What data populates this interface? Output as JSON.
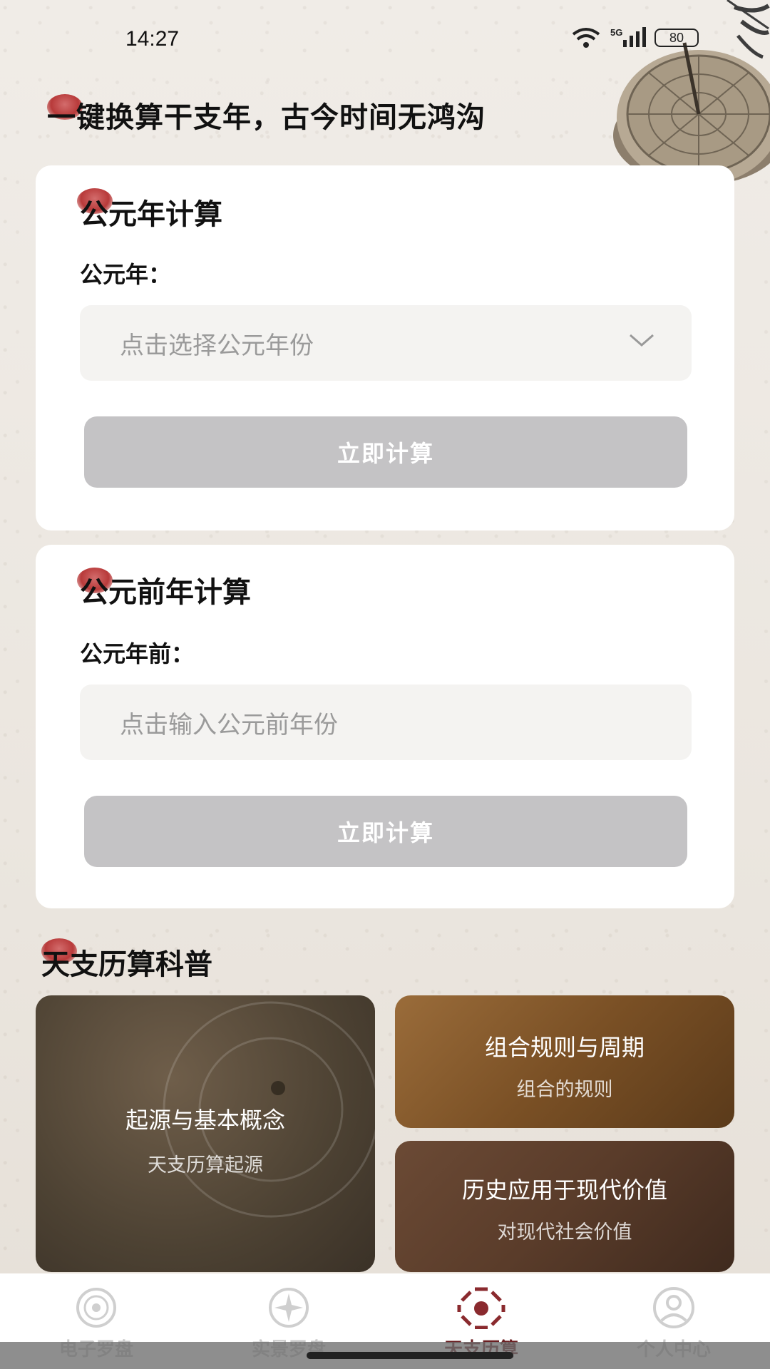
{
  "status": {
    "time": "14:27",
    "network": "5G",
    "battery": "80"
  },
  "headline": "一键换算干支年，古今时间无鸿沟",
  "ad_card": {
    "title": "公元年计算",
    "label": "公元年：",
    "placeholder": "点击选择公元年份",
    "button": "立即计算"
  },
  "bc_card": {
    "title": "公元前年计算",
    "label": "公元年前：",
    "placeholder": "点击输入公元前年份",
    "button": "立即计算"
  },
  "science": {
    "title": "天支历算科普",
    "tiles": [
      {
        "title": "起源与基本概念",
        "subtitle": "天支历算起源"
      },
      {
        "title": "组合规则与周期",
        "subtitle": "组合的规则"
      },
      {
        "title": "历史应用于现代价值",
        "subtitle": "对现代社会价值"
      }
    ]
  },
  "tabbar": {
    "tabs": [
      {
        "label": "电子罗盘",
        "icon": "compass-dial-icon"
      },
      {
        "label": "实景罗盘",
        "icon": "compass-rose-icon"
      },
      {
        "label": "天支历算",
        "icon": "bagua-icon"
      },
      {
        "label": "个人中心",
        "icon": "user-icon"
      }
    ],
    "active_index": 2
  },
  "colors": {
    "accent": "#6b1f22",
    "button_disabled": "#c4c3c5",
    "seal_red": "#b83a3a"
  }
}
